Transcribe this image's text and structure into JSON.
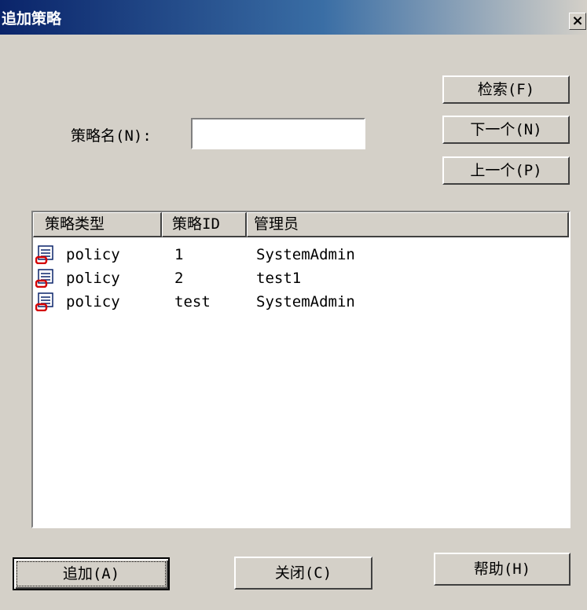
{
  "window": {
    "title": "追加策略",
    "close_glyph": "×"
  },
  "search": {
    "label": "策略名(N):",
    "value": "",
    "search_button": "检索(F)",
    "next_button": "下一个(N)",
    "prev_button": "上一个(P)"
  },
  "list": {
    "columns": [
      "策略类型",
      "策略ID",
      "管理员"
    ],
    "rows": [
      {
        "icon": "policy-icon",
        "type": "policy",
        "id": "1",
        "admin": "SystemAdmin"
      },
      {
        "icon": "policy-icon",
        "type": "policy",
        "id": "2",
        "admin": "test1"
      },
      {
        "icon": "policy-icon",
        "type": "policy",
        "id": "test",
        "admin": "SystemAdmin"
      }
    ]
  },
  "footer": {
    "add_button": "追加(A)",
    "close_button": "关闭(C)",
    "help_button": "帮助(H)"
  },
  "colors": {
    "titlebar_start": "#0a246a",
    "titlebar_end": "#d4d0c8",
    "face": "#d4d0c8"
  }
}
